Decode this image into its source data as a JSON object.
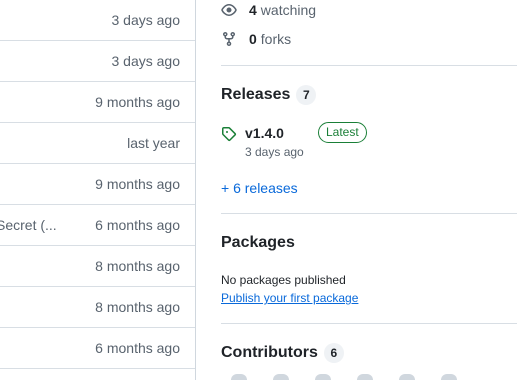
{
  "file_list": {
    "rows": [
      {
        "message": "",
        "time": "3 days ago"
      },
      {
        "message": "",
        "time": "3 days ago"
      },
      {
        "message": "",
        "time": "9 months ago"
      },
      {
        "message": "",
        "time": "last year"
      },
      {
        "message": "",
        "time": "9 months ago"
      },
      {
        "message": "Secret (...",
        "time": "6 months ago"
      },
      {
        "message": "",
        "time": "8 months ago"
      },
      {
        "message": "",
        "time": "8 months ago"
      },
      {
        "message": "",
        "time": "6 months ago"
      }
    ]
  },
  "about": {
    "watching_count": "4",
    "watching_label": "watching",
    "forks_count": "0",
    "forks_label": "forks"
  },
  "releases": {
    "title": "Releases",
    "count": "7",
    "latest": {
      "name": "v1.4.0",
      "badge": "Latest",
      "date": "3 days ago"
    },
    "more_link": "+ 6 releases"
  },
  "packages": {
    "title": "Packages",
    "empty_text": "No packages published",
    "publish_link": "Publish your first package"
  },
  "contributors": {
    "title": "Contributors",
    "count": "6"
  },
  "colors": {
    "accent_link": "#0969da",
    "latest_green": "#1a7f37",
    "muted_text": "#59636e",
    "border": "#d8dee4"
  },
  "icons": [
    "eye-icon",
    "repo-forked-icon",
    "tag-icon"
  ]
}
